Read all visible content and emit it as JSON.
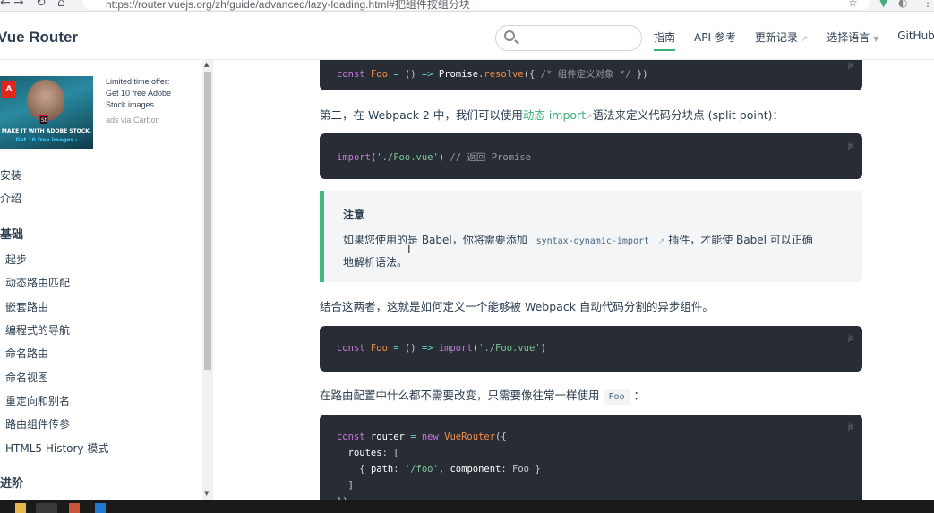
{
  "browser": {
    "back": "←",
    "forward": "→",
    "reload": "↻",
    "home": "⌂",
    "url": "https://router.vuejs.org/zh/guide/advanced/lazy-loading.html#把组件按组分块"
  },
  "navbar": {
    "brand": "Vue Router",
    "search_placeholder": "",
    "links": [
      "指南",
      "API 参考",
      "更新记录",
      "选择语言",
      "GitHub"
    ]
  },
  "ad": {
    "line1": "Limited time offer:",
    "line2": "Get 10 free Adobe",
    "line3": "Stock images.",
    "via": "ads via Carbon",
    "img_make": "MAKE IT WITH ADOBE STOCK.",
    "img_free": "Get 10 free images ›",
    "img_logo": "A",
    "img_badge": "St"
  },
  "sidebar": {
    "items_top": [
      "安装",
      "介绍"
    ],
    "group_basic": "基础",
    "items_basic": [
      "起步",
      "动态路由匹配",
      "嵌套路由",
      "编程式的导航",
      "命名路由",
      "命名视图",
      "重定向和别名",
      "路由组件传参",
      "HTML5 History 模式"
    ],
    "group_advanced": "进阶"
  },
  "content": {
    "code1": [
      "const",
      " Foo ",
      "=",
      " () ",
      "=>",
      " Promise",
      ".",
      "resolve",
      "({ ",
      "/* 组件定义对象 */",
      " })"
    ],
    "para1_a": "第二，在 Webpack 2 中，我们可以使用",
    "para1_link": "动态 import",
    "para1_b": "语法来定义代码分块点 (split point)：",
    "code2": [
      "import",
      "(",
      "'./Foo.vue'",
      ") ",
      "// 返回 Promise"
    ],
    "tip_title": "注意",
    "tip_a": "如果您使用的是 Babel，你将需要添加",
    "tip_code": "syntax-dynamic-import",
    "tip_b": "插件，才能使 Babel 可以正确",
    "tip_c": "地解析语法。",
    "para2": "结合这两者，这就是如何定义一个能够被 Webpack 自动代码分割的异步组件。",
    "code3": [
      "const",
      " Foo ",
      "=",
      " () ",
      "=>",
      " import",
      "(",
      "'./Foo.vue'",
      ")"
    ],
    "para3_a": "在路由配置中什么都不需要改变，只需要像往常一样使用",
    "para3_code": "Foo",
    "para3_b": "：",
    "code4_l1": [
      "const",
      " router ",
      "=",
      " new",
      " VueRouter",
      "({"
    ],
    "code4_l2": [
      "  routes",
      ": ["
    ],
    "code4_l3": [
      "    { ",
      "path",
      ": ",
      "'/foo'",
      ", ",
      "component",
      ": Foo }"
    ],
    "code4_l4": [
      "  ]"
    ],
    "code4_l5": [
      "})"
    ],
    "lang": "js"
  },
  "colors": {
    "accent": "#3eaf7c",
    "code_bg": "#282c34",
    "tip_border": "#42b983"
  }
}
